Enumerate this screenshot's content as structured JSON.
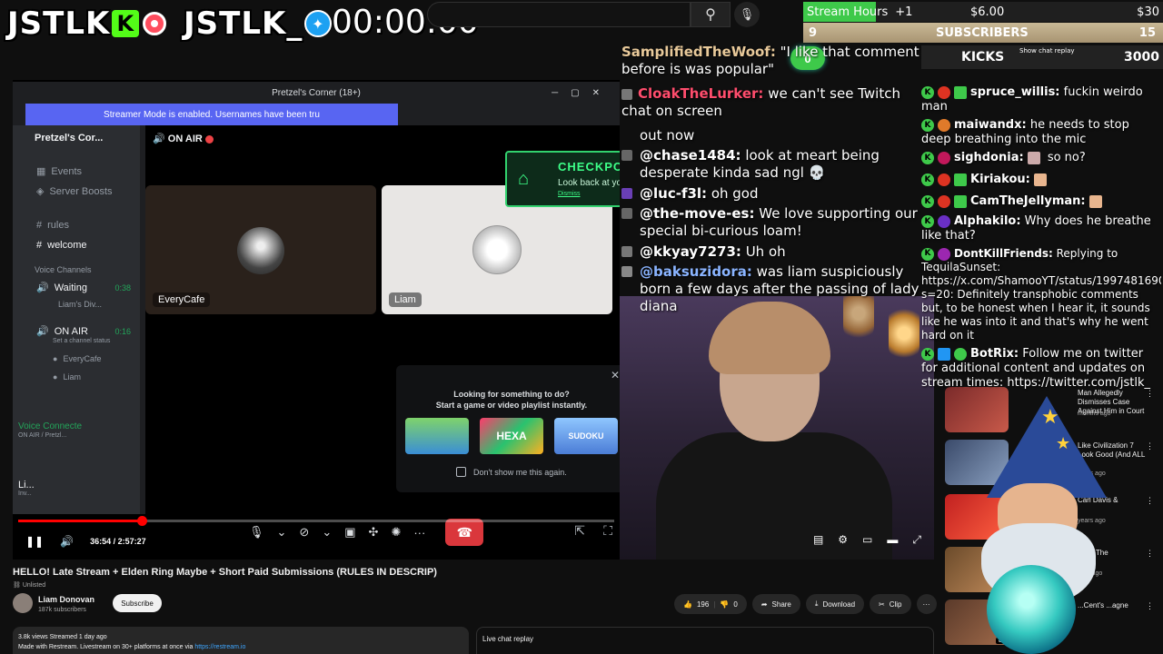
{
  "overlay": {
    "logo1": "JSTLK",
    "logo1_badge": "K",
    "logo2": "JSTLK_",
    "timer": "00:00:00",
    "goal_stream_hours": "Stream Hours",
    "goal_stream_hours_delta": "+1",
    "goal_stream_hours_current": "$6.00",
    "goal_stream_hours_target": "$30",
    "subs_count": "9",
    "subs_label": "SUBSCRIBERS",
    "subs_target": "15",
    "kicks_label": "KICKS",
    "kicks_target": "3000",
    "kicks_badge": "0",
    "show_chat_replay": "Show chat replay"
  },
  "discord": {
    "window_title": "Pretzel's Corner (18+)",
    "banner": "Streamer Mode is enabled. Usernames have been tru",
    "server_name": "Pretzel's Cor...",
    "onair_header": "ON AIR",
    "sidebar": {
      "events": "Events",
      "server_boosts": "Server Boosts",
      "rules": "rules",
      "welcome": "welcome",
      "voice_channels": "Voice Channels",
      "waiting": "Waiting",
      "waiting_time": "0:38",
      "waiting_user": "Liam's Div...",
      "onair": "ON AIR",
      "onair_time": "0:16",
      "set_status": "Set a channel status",
      "user1": "EveryCafe",
      "user2": "Liam",
      "voice_connected": "Voice Connecte",
      "voice_sub": "ON AIR / Pretzl...",
      "me_name": "Li...",
      "me_sub": "Inv..."
    },
    "tile1_name": "EveryCafe",
    "tile2_name": "Liam",
    "checkpoint_title": "CHECKPOINT",
    "checkpoint_sub": "Look back at your 2025 on Discord",
    "checkpoint_link": "Dismiss",
    "popup_title_1": "Looking for something to do?",
    "popup_title_2": "Start a game or video playlist instantly.",
    "game1": "",
    "game2": "HEXA",
    "game3": "SUDOKU",
    "dont_show": "Don't show me this again."
  },
  "player": {
    "time": "36:54 / 2:57:27",
    "progress": 0.208
  },
  "chat_mid": [
    {
      "name": "SamplifiedTheWoof:",
      "text": " \"I like that comment before is was popular\"",
      "color": "#e8c99a"
    },
    {
      "name": "CloakTheLurker:",
      "text": " we can't see Twitch chat on screen",
      "color": "#ff4d6d"
    },
    {
      "name": "",
      "text": "out now",
      "color": "#fff"
    },
    {
      "name": "@chase1484:",
      "text": " look at meart being desperate kinda sad ngl 💀",
      "color": "#fff"
    },
    {
      "name": "@luc-f3l:",
      "text": " oh god",
      "color": "#fff"
    },
    {
      "name": "@the-move-es:",
      "text": " We love supporting our special bi-curious loam!",
      "color": "#fff"
    },
    {
      "name": "@kkyay7273:",
      "text": " Uh oh",
      "color": "#fff"
    },
    {
      "name": "@baksuzidora:",
      "text": " was liam suspiciously born a few days after the passing of lady diana",
      "color": "#8ab4ff"
    }
  ],
  "chat_right": [
    {
      "name": "spruce_willis:",
      "text": " fuckin weirdo man",
      "color": "#fff"
    },
    {
      "name": "maiwandx:",
      "text": " he needs to stop deep breathing into the mic",
      "color": "#fff"
    },
    {
      "name": "sighdonia:",
      "text": " so no?",
      "color": "#fff"
    },
    {
      "name": "Kiriakou:",
      "text": "",
      "color": "#fff"
    },
    {
      "name": "CamTheJellyman:",
      "text": "",
      "color": "#fff"
    },
    {
      "name": "Alphakilo:",
      "text": " Why does he breathe like that?",
      "color": "#fff"
    },
    {
      "name": "DontKillFriends:",
      "text": " Replying to TequilaSunset: https://x.com/ShamooYT/status/1997481690843984291?s=20: Definitely transphobic comments but, to be honest when I hear it, it sounds like he was into it and that's why he went hard on it",
      "color": "#fff"
    },
    {
      "name": "BotRix:",
      "text": " Follow me on twitter for additional content and updates on stream times: https://twitter.com/jstlk_",
      "color": "#fff"
    }
  ],
  "reco": [
    {
      "title": "Man Allegedly Dismisses Case Against Him in Court",
      "meta": "months ago"
    },
    {
      "title": "Like Civilization 7 Look Good (And ALL ...",
      "meta": "years ago"
    },
    {
      "title": "Carl Davis &",
      "meta": "years ago"
    },
    {
      "title": "...out The",
      "meta": "ears ago"
    },
    {
      "title": "...Cent's ...agne",
      "meta": "8:26"
    }
  ],
  "video": {
    "title": "HELLO! Late Stream + Elden Ring Maybe + Short Paid Submissions (RULES IN DESCRIP)",
    "unlisted": "Unlisted",
    "channel": "Liam Donovan",
    "subscribers": "187k subscribers",
    "subscribe": "Subscribe",
    "likes": "196",
    "dislikes": "0",
    "share": "Share",
    "download": "Download",
    "clip": "Clip",
    "desc_line1": "3.8k views  Streamed 1 day ago",
    "desc_line2": "Made with Restream. Livestream on 30+ platforms at once via ",
    "desc_link": "https://restream.io",
    "live_chat_replay": "Live chat replay"
  }
}
